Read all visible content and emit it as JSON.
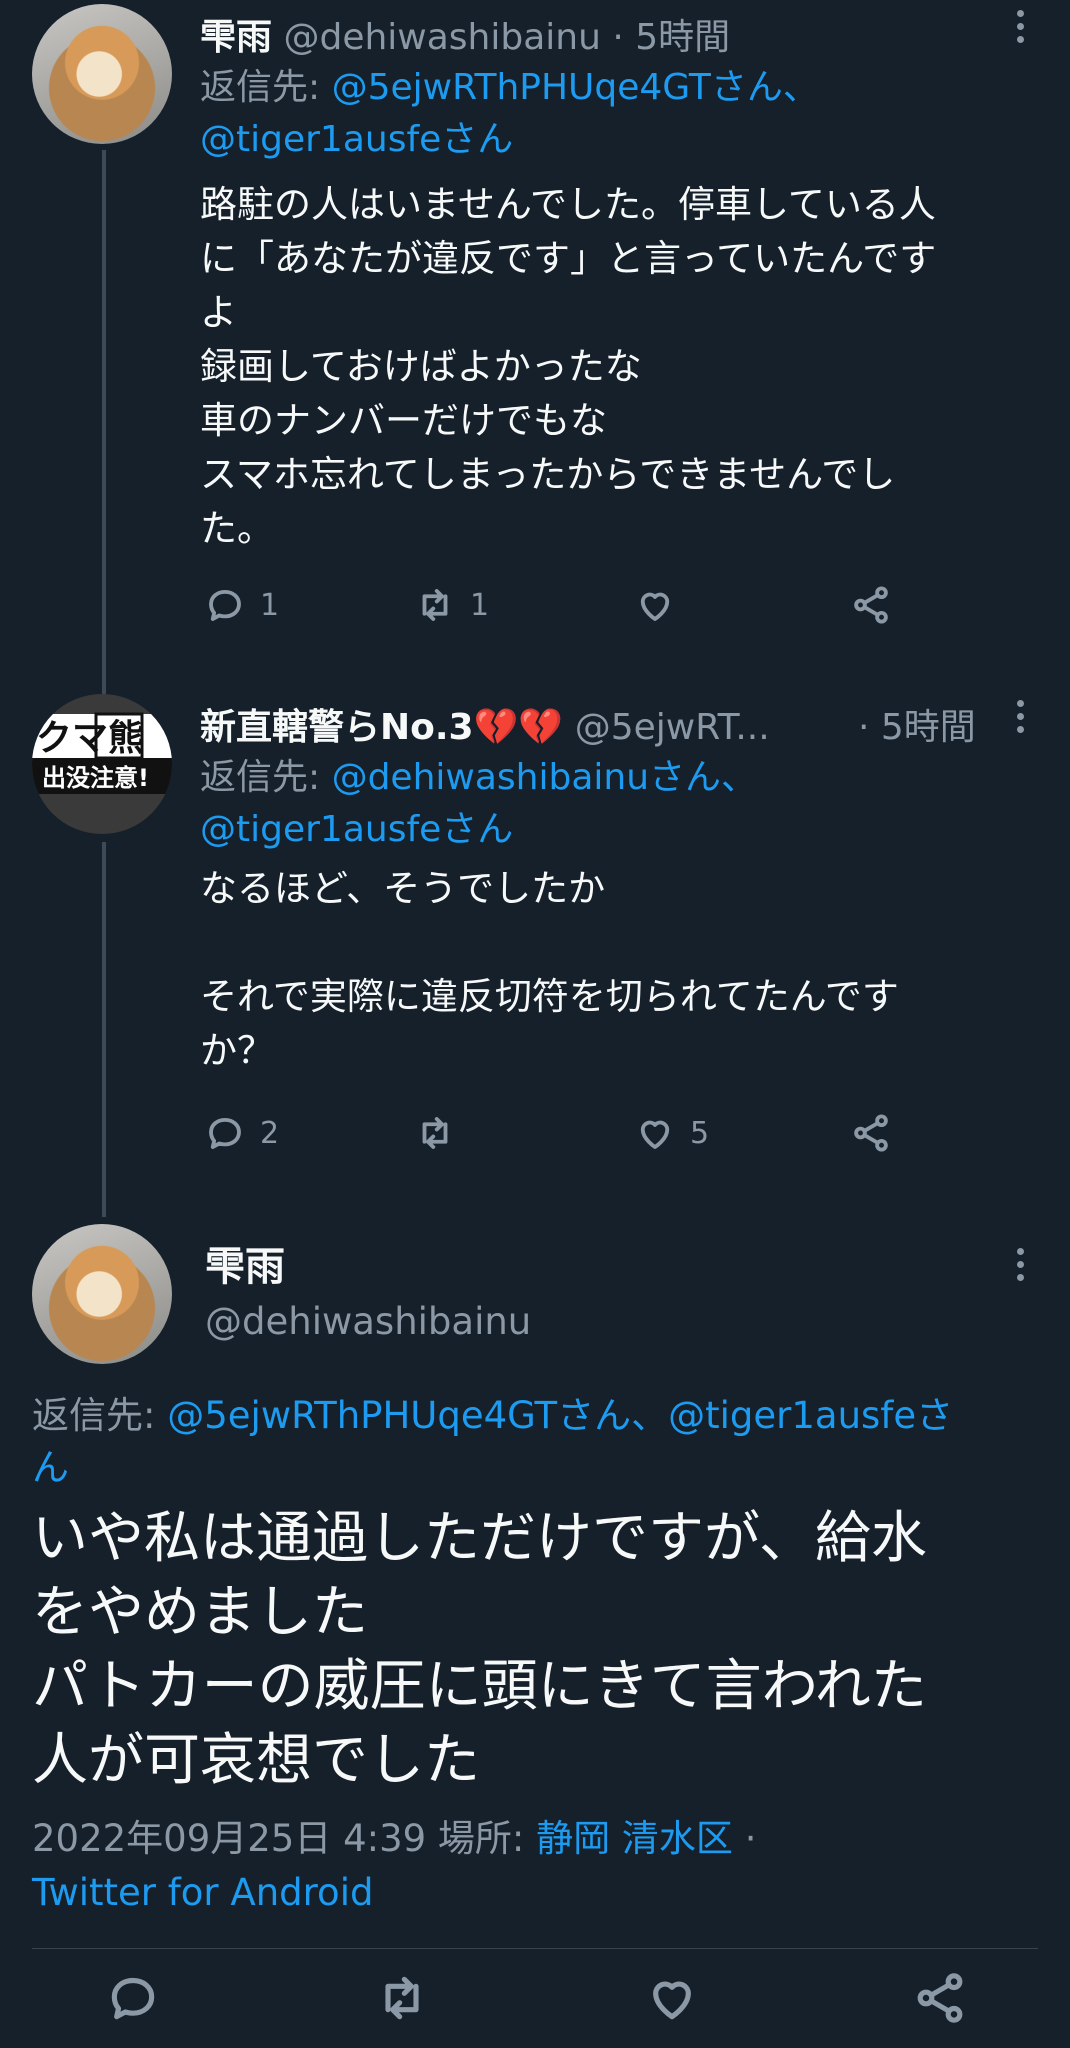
{
  "tweets": [
    {
      "name": "雫雨",
      "handle": "@dehiwashibainu",
      "time": "· 5時間",
      "reply_prefix": "返信先: ",
      "reply_mentions_line1": "@5ejwRThPHUqe4GTさん、",
      "reply_mentions_line2": "@tiger1ausfeさん",
      "body": "路駐の人はいませんでした。停車している人\nに「あなたが違反です」と言っていたんです\nよ\n録画しておけばよかったな\n車のナンバーだけでもな\nスマホ忘れてしまったからできませんでし\nた。",
      "replies": "1",
      "retweets": "1",
      "likes": ""
    },
    {
      "name": "新直轄警らNo.3💔💔",
      "handle": "@5ejwRT...",
      "time": "· 5時間",
      "reply_prefix": "返信先: ",
      "reply_mentions_line1": "@dehiwashibainuさん、",
      "reply_mentions_line2": "@tiger1ausfeさん",
      "body": "なるほど、そうでしたか\n\nそれで実際に違反切符を切られてたんです\nか？",
      "replies": "2",
      "retweets": "",
      "likes": "5",
      "avatar_sign_text_top": "クマ熊",
      "avatar_sign_text_bottom": "出没注意!"
    }
  ],
  "main_tweet": {
    "name": "雫雨",
    "handle": "@dehiwashibainu",
    "reply_prefix": "返信先: ",
    "reply_mentions": "@5ejwRThPHUqe4GTさん、@tiger1ausfeさ",
    "reply_mentions_wrap": "ん",
    "body": "いや私は通過しただけですが、給水\nをやめました\nパトカーの威圧に頭にきて言われた\n人が可哀想でした",
    "timestamp": "2022年09月25日 4:39 場所: ",
    "location": "静岡 清水区",
    "sep": " ·",
    "client": "Twitter for Android"
  },
  "icons": [
    "reply-icon",
    "retweet-icon",
    "like-icon",
    "share-icon",
    "more-icon"
  ],
  "colors": {
    "background": "#15202b",
    "accent": "#1d9bf0",
    "muted": "#8b98a5"
  }
}
